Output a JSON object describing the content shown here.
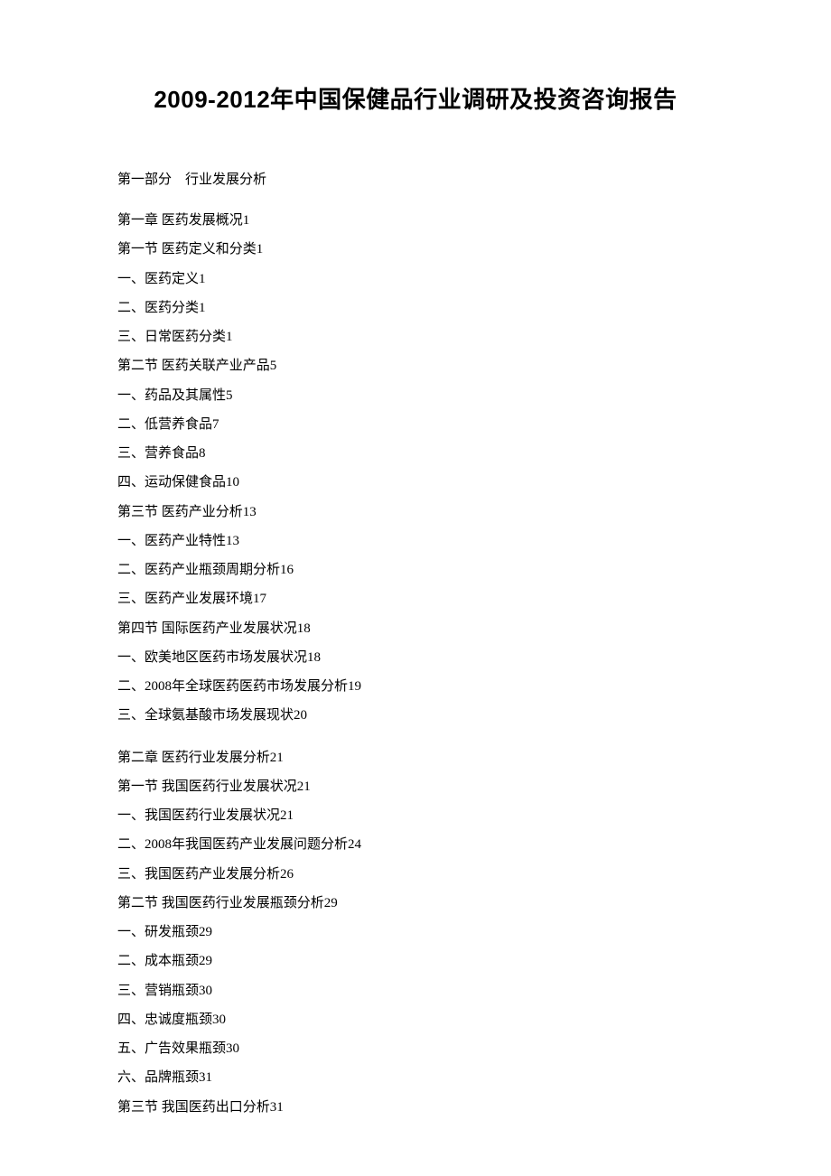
{
  "title": "2009-2012年中国保健品行业调研及投资咨询报告",
  "part_heading": "第一部分　行业发展分析",
  "toc": [
    "第一章 医药发展概况1",
    "第一节 医药定义和分类1",
    "一、医药定义1",
    "二、医药分类1",
    "三、日常医药分类1",
    "第二节 医药关联产业产品5",
    "一、药品及其属性5",
    "二、低营养食品7",
    "三、营养食品8",
    "四、运动保健食品10",
    "第三节 医药产业分析13",
    "一、医药产业特性13",
    "二、医药产业瓶颈周期分析16",
    "三、医药产业发展环境17",
    "第四节 国际医药产业发展状况18",
    "一、欧美地区医药市场发展状况18",
    "二、2008年全球医药医药市场发展分析19",
    "三、全球氨基酸市场发展现状20",
    "",
    "第二章 医药行业发展分析21",
    "第一节 我国医药行业发展状况21",
    "一、我国医药行业发展状况21",
    "二、2008年我国医药产业发展问题分析24",
    "三、我国医药产业发展分析26",
    "第二节 我国医药行业发展瓶颈分析29",
    "一、研发瓶颈29",
    "二、成本瓶颈29",
    "三、营销瓶颈30",
    "四、忠诚度瓶颈30",
    "五、广告效果瓶颈30",
    "六、品牌瓶颈31",
    "第三节 我国医药出口分析31"
  ]
}
